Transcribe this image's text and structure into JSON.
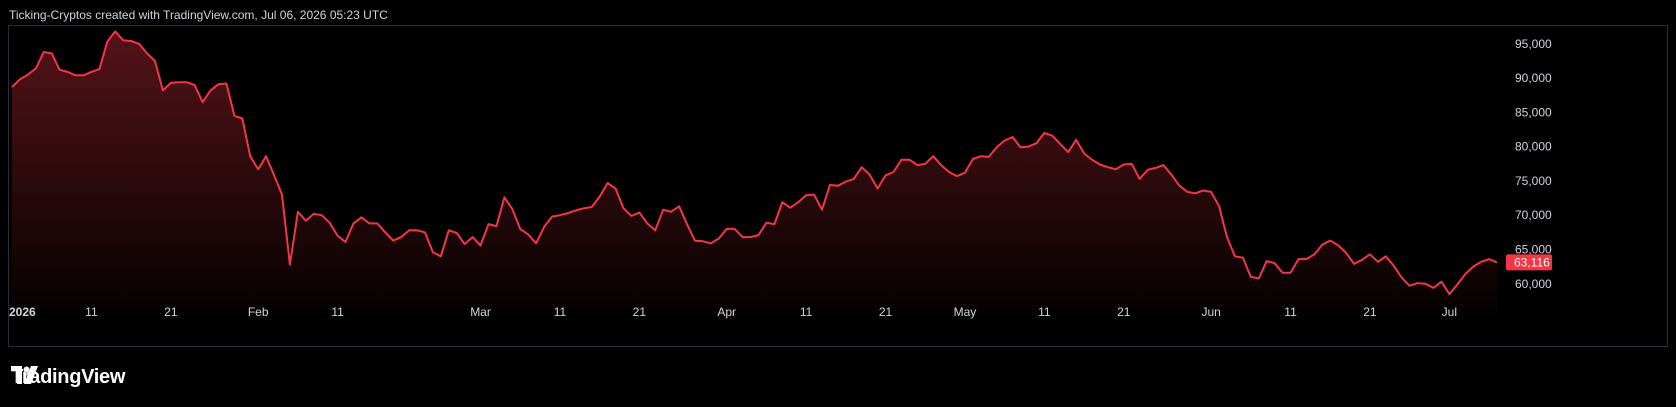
{
  "header": {
    "attribution": "Ticking-Cryptos created with TradingView.com, Jul 06, 2026 05:23 UTC"
  },
  "brand": {
    "name": "TradingView",
    "logo_icon": "tradingview-logo-icon"
  },
  "colors": {
    "line": "#f23645",
    "background": "#000000",
    "price_badge": "#f23645",
    "text": "#d1d4dc",
    "border": "#2a2e39"
  },
  "chart_data": {
    "type": "area",
    "title": "",
    "xlabel": "",
    "ylabel": "",
    "ylim": [
      55300,
      97300
    ],
    "grid": false,
    "legend": "none",
    "current_price": 63116,
    "current_price_label": "63,116",
    "y_ticks": [
      {
        "value": 95000,
        "label": "95,000"
      },
      {
        "value": 90000,
        "label": "90,000"
      },
      {
        "value": 85000,
        "label": "85,000"
      },
      {
        "value": 80000,
        "label": "80,000"
      },
      {
        "value": 75000,
        "label": "75,000"
      },
      {
        "value": 70000,
        "label": "70,000"
      },
      {
        "value": 65000,
        "label": "65,000"
      },
      {
        "value": 60000,
        "label": "60,000"
      }
    ],
    "x_ticks": [
      {
        "date": "2026-01-01",
        "label": "2026",
        "bold": true
      },
      {
        "date": "2026-01-11",
        "label": "11"
      },
      {
        "date": "2026-01-21",
        "label": "21"
      },
      {
        "date": "2026-02-01",
        "label": "Feb"
      },
      {
        "date": "2026-02-11",
        "label": "11"
      },
      {
        "date": "2026-03-01",
        "label": "Mar"
      },
      {
        "date": "2026-03-11",
        "label": "11"
      },
      {
        "date": "2026-03-21",
        "label": "21"
      },
      {
        "date": "2026-04-01",
        "label": "Apr"
      },
      {
        "date": "2026-04-11",
        "label": "11"
      },
      {
        "date": "2026-04-21",
        "label": "21"
      },
      {
        "date": "2026-05-01",
        "label": "May"
      },
      {
        "date": "2026-05-11",
        "label": "11"
      },
      {
        "date": "2026-05-21",
        "label": "21"
      },
      {
        "date": "2026-06-01",
        "label": "Jun"
      },
      {
        "date": "2026-06-11",
        "label": "11"
      },
      {
        "date": "2026-06-21",
        "label": "21"
      },
      {
        "date": "2026-07-01",
        "label": "Jul"
      }
    ],
    "series": [
      {
        "points": [
          [
            "2026-01-01",
            88700
          ],
          [
            "2026-01-02",
            89800
          ],
          [
            "2026-01-03",
            90500
          ],
          [
            "2026-01-04",
            91400
          ],
          [
            "2026-01-05",
            93800
          ],
          [
            "2026-01-06",
            93600
          ],
          [
            "2026-01-07",
            91200
          ],
          [
            "2026-01-08",
            90900
          ],
          [
            "2026-01-09",
            90400
          ],
          [
            "2026-01-10",
            90400
          ],
          [
            "2026-01-11",
            90900
          ],
          [
            "2026-01-12",
            91300
          ],
          [
            "2026-01-13",
            95300
          ],
          [
            "2026-01-14",
            96800
          ],
          [
            "2026-01-15",
            95500
          ],
          [
            "2026-01-16",
            95400
          ],
          [
            "2026-01-17",
            95000
          ],
          [
            "2026-01-18",
            93600
          ],
          [
            "2026-01-19",
            92500
          ],
          [
            "2026-01-20",
            88200
          ],
          [
            "2026-01-21",
            89300
          ],
          [
            "2026-01-22",
            89400
          ],
          [
            "2026-01-23",
            89400
          ],
          [
            "2026-01-24",
            89000
          ],
          [
            "2026-01-25",
            86500
          ],
          [
            "2026-01-26",
            88200
          ],
          [
            "2026-01-27",
            89100
          ],
          [
            "2026-01-28",
            89200
          ],
          [
            "2026-01-29",
            84500
          ],
          [
            "2026-01-30",
            84100
          ],
          [
            "2026-01-31",
            78600
          ],
          [
            "2026-02-01",
            76700
          ],
          [
            "2026-02-02",
            78600
          ],
          [
            "2026-02-03",
            75800
          ],
          [
            "2026-02-04",
            73000
          ],
          [
            "2026-02-05",
            62800
          ],
          [
            "2026-02-06",
            70500
          ],
          [
            "2026-02-07",
            69200
          ],
          [
            "2026-02-08",
            70200
          ],
          [
            "2026-02-09",
            70000
          ],
          [
            "2026-02-10",
            68900
          ],
          [
            "2026-02-11",
            67000
          ],
          [
            "2026-02-12",
            66100
          ],
          [
            "2026-02-13",
            68800
          ],
          [
            "2026-02-14",
            69700
          ],
          [
            "2026-02-15",
            68800
          ],
          [
            "2026-02-16",
            68800
          ],
          [
            "2026-02-17",
            67500
          ],
          [
            "2026-02-18",
            66300
          ],
          [
            "2026-02-19",
            66800
          ],
          [
            "2026-02-20",
            67800
          ],
          [
            "2026-02-21",
            67800
          ],
          [
            "2026-02-22",
            67500
          ],
          [
            "2026-02-23",
            64600
          ],
          [
            "2026-02-24",
            64000
          ],
          [
            "2026-02-25",
            67800
          ],
          [
            "2026-02-26",
            67400
          ],
          [
            "2026-02-27",
            65800
          ],
          [
            "2026-02-28",
            66800
          ],
          [
            "2026-03-01",
            65600
          ],
          [
            "2026-03-02",
            68700
          ],
          [
            "2026-03-03",
            68400
          ],
          [
            "2026-03-04",
            72600
          ],
          [
            "2026-03-05",
            70900
          ],
          [
            "2026-03-06",
            68000
          ],
          [
            "2026-03-07",
            67200
          ],
          [
            "2026-03-08",
            65900
          ],
          [
            "2026-03-09",
            68300
          ],
          [
            "2026-03-10",
            69800
          ],
          [
            "2026-03-11",
            70000
          ],
          [
            "2026-03-12",
            70300
          ],
          [
            "2026-03-13",
            70700
          ],
          [
            "2026-03-14",
            71000
          ],
          [
            "2026-03-15",
            71200
          ],
          [
            "2026-03-16",
            72700
          ],
          [
            "2026-03-17",
            74700
          ],
          [
            "2026-03-18",
            73900
          ],
          [
            "2026-03-19",
            71000
          ],
          [
            "2026-03-20",
            69900
          ],
          [
            "2026-03-21",
            70400
          ],
          [
            "2026-03-22",
            68800
          ],
          [
            "2026-03-23",
            67800
          ],
          [
            "2026-03-24",
            70800
          ],
          [
            "2026-03-25",
            70500
          ],
          [
            "2026-03-26",
            71300
          ],
          [
            "2026-03-27",
            68700
          ],
          [
            "2026-03-28",
            66300
          ],
          [
            "2026-03-29",
            66200
          ],
          [
            "2026-03-30",
            65900
          ],
          [
            "2026-03-31",
            66600
          ],
          [
            "2026-04-01",
            68000
          ],
          [
            "2026-04-02",
            68000
          ],
          [
            "2026-04-03",
            66800
          ],
          [
            "2026-04-04",
            66800
          ],
          [
            "2026-04-05",
            67100
          ],
          [
            "2026-04-06",
            68900
          ],
          [
            "2026-04-07",
            68700
          ],
          [
            "2026-04-08",
            71900
          ],
          [
            "2026-04-09",
            71100
          ],
          [
            "2026-04-10",
            71900
          ],
          [
            "2026-04-11",
            72900
          ],
          [
            "2026-04-12",
            73000
          ],
          [
            "2026-04-13",
            70800
          ],
          [
            "2026-04-14",
            74400
          ],
          [
            "2026-04-15",
            74300
          ],
          [
            "2026-04-16",
            74900
          ],
          [
            "2026-04-17",
            75300
          ],
          [
            "2026-04-18",
            77000
          ],
          [
            "2026-04-19",
            75900
          ],
          [
            "2026-04-20",
            73900
          ],
          [
            "2026-04-21",
            75800
          ],
          [
            "2026-04-22",
            76300
          ],
          [
            "2026-04-23",
            78100
          ],
          [
            "2026-04-24",
            78100
          ],
          [
            "2026-04-25",
            77300
          ],
          [
            "2026-04-26",
            77500
          ],
          [
            "2026-04-27",
            78600
          ],
          [
            "2026-04-28",
            77300
          ],
          [
            "2026-04-29",
            76300
          ],
          [
            "2026-04-30",
            75700
          ],
          [
            "2026-05-01",
            76200
          ],
          [
            "2026-05-02",
            78200
          ],
          [
            "2026-05-03",
            78600
          ],
          [
            "2026-05-04",
            78500
          ],
          [
            "2026-05-05",
            79900
          ],
          [
            "2026-05-06",
            80900
          ],
          [
            "2026-05-07",
            81400
          ],
          [
            "2026-05-08",
            79900
          ],
          [
            "2026-05-09",
            80000
          ],
          [
            "2026-05-10",
            80500
          ],
          [
            "2026-05-11",
            82000
          ],
          [
            "2026-05-12",
            81600
          ],
          [
            "2026-05-13",
            80400
          ],
          [
            "2026-05-14",
            79200
          ],
          [
            "2026-05-15",
            81000
          ],
          [
            "2026-05-16",
            79000
          ],
          [
            "2026-05-17",
            78100
          ],
          [
            "2026-05-18",
            77400
          ],
          [
            "2026-05-19",
            77000
          ],
          [
            "2026-05-20",
            76700
          ],
          [
            "2026-05-21",
            77400
          ],
          [
            "2026-05-22",
            77500
          ],
          [
            "2026-05-23",
            75300
          ],
          [
            "2026-05-24",
            76600
          ],
          [
            "2026-05-25",
            76900
          ],
          [
            "2026-05-26",
            77300
          ],
          [
            "2026-05-27",
            75900
          ],
          [
            "2026-05-28",
            74300
          ],
          [
            "2026-05-29",
            73400
          ],
          [
            "2026-05-30",
            73200
          ],
          [
            "2026-05-31",
            73600
          ],
          [
            "2026-06-01",
            73400
          ],
          [
            "2026-06-02",
            71300
          ],
          [
            "2026-06-03",
            66800
          ],
          [
            "2026-06-04",
            64000
          ],
          [
            "2026-06-05",
            63800
          ],
          [
            "2026-06-06",
            61000
          ],
          [
            "2026-06-07",
            60800
          ],
          [
            "2026-06-08",
            63300
          ],
          [
            "2026-06-09",
            63000
          ],
          [
            "2026-06-10",
            61600
          ],
          [
            "2026-06-11",
            61600
          ],
          [
            "2026-06-12",
            63600
          ],
          [
            "2026-06-13",
            63600
          ],
          [
            "2026-06-14",
            64300
          ],
          [
            "2026-06-15",
            65700
          ],
          [
            "2026-06-16",
            66300
          ],
          [
            "2026-06-17",
            65600
          ],
          [
            "2026-06-18",
            64500
          ],
          [
            "2026-06-19",
            62900
          ],
          [
            "2026-06-20",
            63500
          ],
          [
            "2026-06-21",
            64300
          ],
          [
            "2026-06-22",
            63200
          ],
          [
            "2026-06-23",
            64000
          ],
          [
            "2026-06-24",
            62600
          ],
          [
            "2026-06-25",
            60900
          ],
          [
            "2026-06-26",
            59700
          ],
          [
            "2026-06-27",
            60100
          ],
          [
            "2026-06-28",
            60000
          ],
          [
            "2026-06-29",
            59400
          ],
          [
            "2026-06-30",
            60300
          ],
          [
            "2026-07-01",
            58500
          ],
          [
            "2026-07-02",
            59900
          ],
          [
            "2026-07-03",
            61400
          ],
          [
            "2026-07-04",
            62500
          ],
          [
            "2026-07-05",
            63200
          ],
          [
            "2026-07-06",
            63600
          ],
          [
            "2026-07-07",
            63116
          ]
        ]
      }
    ]
  }
}
